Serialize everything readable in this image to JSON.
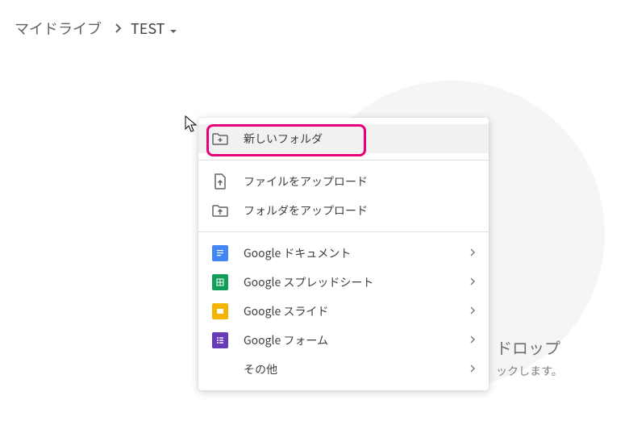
{
  "breadcrumb": {
    "root": "マイドライブ",
    "current": "TEST"
  },
  "context_menu": {
    "new_folder": "新しいフォルダ",
    "upload_file": "ファイルをアップロード",
    "upload_folder": "フォルダをアップロード",
    "g_docs": "Google ドキュメント",
    "g_sheets": "Google スプレッドシート",
    "g_slides": "Google スライド",
    "g_forms": "Google フォーム",
    "other": "その他"
  },
  "background": {
    "drop_text": "ドロップ",
    "click_text": "ックします。"
  }
}
